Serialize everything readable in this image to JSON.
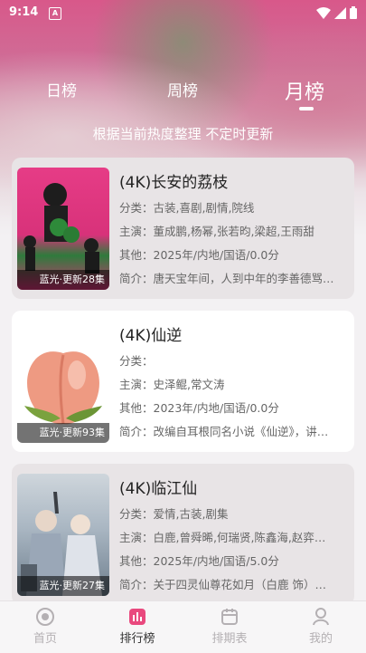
{
  "status": {
    "time": "9:14",
    "app_indicator": "A"
  },
  "tabs": [
    {
      "label": "日榜"
    },
    {
      "label": "周榜"
    },
    {
      "label": "月榜"
    }
  ],
  "active_tab": "月榜",
  "subtitle": "根据当前热度整理 不定时更新",
  "items": [
    {
      "title": "(4K)长安的荔枝",
      "category": "分类：古装,喜剧,剧情,院线",
      "cast": "主演：董成鹏,杨幂,张若昀,梁超,王雨甜",
      "other": "其他：2025年/内地/国语/0.0分",
      "intro": "简介：唐天宝年间，人到中年的李善德骂…",
      "badge": "蓝光·更新28集"
    },
    {
      "title": "(4K)仙逆",
      "category": "分类：",
      "cast": "主演：史泽鲲,常文涛",
      "other": "其他：2023年/内地/国语/0.0分",
      "intro": "简介：改编自耳根同名小说《仙逆》，讲…",
      "badge": "蓝光·更新93集"
    },
    {
      "title": "(4K)临江仙",
      "category": "分类：爱情,古装,剧集",
      "cast": "主演：白鹿,曾舜晞,何瑞贤,陈鑫海,赵弈…",
      "other": "其他：2025年/内地/国语/5.0分",
      "intro": "简介：关于四灵仙尊花如月（白鹿 饰）…",
      "badge": "蓝光·更新27集"
    }
  ],
  "nav": [
    {
      "label": "首页",
      "icon": "home-icon"
    },
    {
      "label": "排行榜",
      "icon": "ranking-icon"
    },
    {
      "label": "排期表",
      "icon": "calendar-icon"
    },
    {
      "label": "我的",
      "icon": "profile-icon"
    }
  ],
  "colors": {
    "accent": "#d8588a",
    "nav_active": "#333333",
    "nav_inactive": "#b4b0b3"
  }
}
